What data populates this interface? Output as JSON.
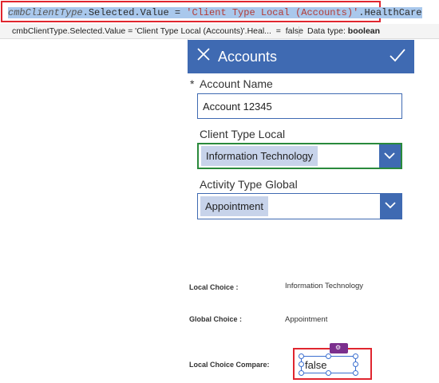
{
  "formula_bar": {
    "control_name": "cmbClientType",
    "segment_selected_value": ".Selected.Value = ",
    "string_literal": "'Client Type Local (Accounts)'",
    "segment_member": ".HealthCare"
  },
  "result_strip": {
    "expression": "cmbClientType.Selected.Value = 'Client Type Local (Accounts)'.Heal...",
    "equals": "=",
    "result": "false",
    "type_label": "Data type:",
    "type_value": "boolean"
  },
  "header": {
    "title": "Accounts",
    "close_icon": "close-icon",
    "check_icon": "checkmark-icon",
    "bg_color": "#3f6ab2"
  },
  "form": {
    "required_marker": "*",
    "account_name_label": "Account Name",
    "account_name_value": "Account 12345",
    "client_type_label": "Client Type Local",
    "client_type_value": "Information Technology",
    "activity_type_label": "Activity Type Global",
    "activity_type_value": "Appointment"
  },
  "details": {
    "local_choice_label": "Local Choice :",
    "local_choice_value": "Information Technology",
    "global_choice_label": "Global Choice :",
    "global_choice_value": "Appointment",
    "compare_label": "Local Choice  Compare:",
    "compare_value": "false"
  },
  "colors": {
    "accent": "#3f6ab2",
    "highlight_red": "#e0262f",
    "focus_green": "#2a8a3c",
    "badge_purple": "#7b2f8d"
  }
}
